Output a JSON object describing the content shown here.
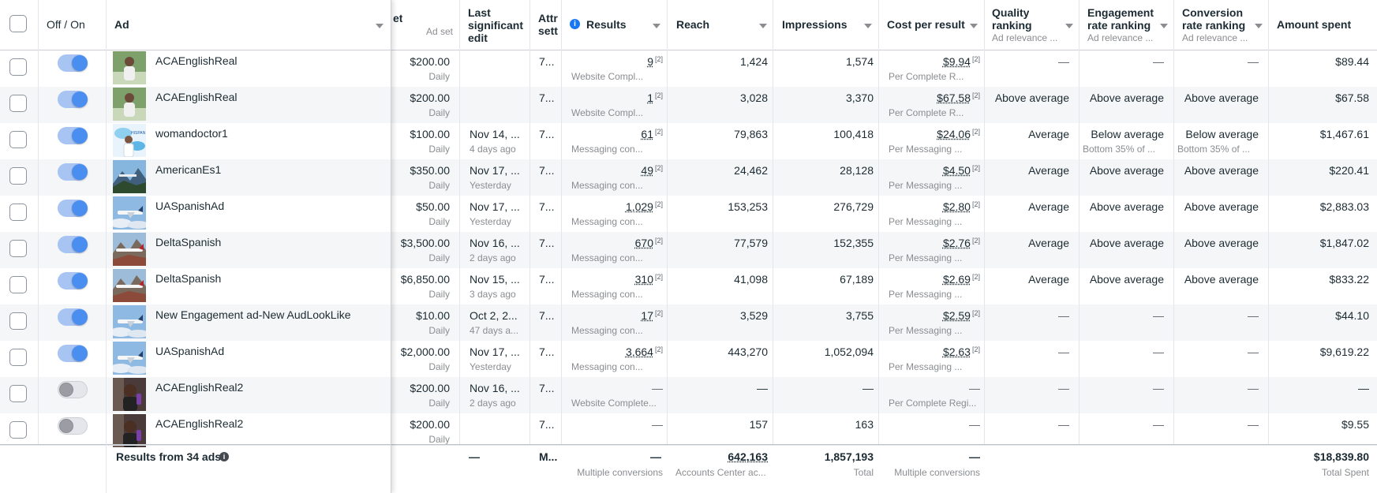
{
  "header": {
    "ad_col": "Ad",
    "budget_fragment": "et",
    "budget_sub": "Ad set",
    "last_edit": [
      "Last",
      "significant",
      "edit"
    ],
    "attribution": [
      "Attr",
      "sett"
    ],
    "results": "Results",
    "reach": "Reach",
    "impressions": "Impressions",
    "cost_per_result": "Cost per result",
    "quality": "Quality",
    "quality_2": "ranking",
    "quality_sub": "Ad relevance ...",
    "engagement": "Engagement",
    "engagement_2": "rate ranking",
    "engagement_sub": "Ad relevance ...",
    "conversion": "Conversion",
    "conversion_2": "rate ranking",
    "conversion_sub": "Ad relevance ...",
    "amount_spent": "Amount spent",
    "off_on": "Off / On"
  },
  "rows": [
    {
      "on": true,
      "ad": "ACAEnglishReal",
      "thumb": "person-green",
      "budget": "$200.00",
      "budget_sub": "Daily",
      "edit": "",
      "edit_sub": "",
      "attr": "7...",
      "results": "9",
      "results_sub": "Website Compl...",
      "reach": "1,424",
      "impressions": "1,574",
      "cpr": "$9.94",
      "cpr_sub": "Per Complete R...",
      "quality": "—",
      "quality_sub": "",
      "engagement": "—",
      "engagement_sub": "",
      "conversion": "—",
      "conversion_sub": "",
      "spent": "$89.44"
    },
    {
      "on": true,
      "ad": "ACAEnglishReal",
      "thumb": "person-green",
      "budget": "$200.00",
      "budget_sub": "Daily",
      "edit": "",
      "edit_sub": "",
      "attr": "7...",
      "results": "1",
      "results_sub": "Website Compl...",
      "reach": "3,028",
      "impressions": "3,370",
      "cpr": "$67.58",
      "cpr_sub": "Per Complete R...",
      "quality": "Above average",
      "quality_sub": "",
      "engagement": "Above average",
      "engagement_sub": "",
      "conversion": "Above average",
      "conversion_sub": "",
      "spent": "$67.58"
    },
    {
      "on": true,
      "ad": "womandoctor1",
      "thumb": "doctor",
      "budget": "$100.00",
      "budget_sub": "Daily",
      "edit": "Nov 14, ...",
      "edit_sub": "4 days ago",
      "attr": "7...",
      "results": "61",
      "results_sub": "Messaging con...",
      "reach": "79,863",
      "impressions": "100,418",
      "cpr": "$24.06",
      "cpr_sub": "Per Messaging ...",
      "quality": "Average",
      "quality_sub": "",
      "engagement": "Below average",
      "engagement_sub": "Bottom 35% of ...",
      "conversion": "Below average",
      "conversion_sub": "Bottom 35% of ...",
      "spent": "$1,467.61"
    },
    {
      "on": true,
      "ad": "AmericanEs1",
      "thumb": "mountain",
      "budget": "$350.00",
      "budget_sub": "Daily",
      "edit": "Nov 17, ...",
      "edit_sub": "Yesterday",
      "attr": "7...",
      "results": "49",
      "results_sub": "Messaging con...",
      "reach": "24,462",
      "impressions": "28,128",
      "cpr": "$4.50",
      "cpr_sub": "Per Messaging ...",
      "quality": "Average",
      "quality_sub": "",
      "engagement": "Above average",
      "engagement_sub": "",
      "conversion": "Above average",
      "conversion_sub": "",
      "spent": "$220.41"
    },
    {
      "on": true,
      "ad": "UASpanishAd",
      "thumb": "plane-sky",
      "budget": "$50.00",
      "budget_sub": "Daily",
      "edit": "Nov 17, ...",
      "edit_sub": "Yesterday",
      "attr": "7...",
      "results": "1,029",
      "results_sub": "Messaging con...",
      "reach": "153,253",
      "impressions": "276,729",
      "cpr": "$2.80",
      "cpr_sub": "Per Messaging ...",
      "quality": "Average",
      "quality_sub": "",
      "engagement": "Above average",
      "engagement_sub": "",
      "conversion": "Above average",
      "conversion_sub": "",
      "spent": "$2,883.03"
    },
    {
      "on": true,
      "ad": "DeltaSpanish",
      "thumb": "plane-mountain",
      "budget": "$3,500.00",
      "budget_sub": "Daily",
      "edit": "Nov 16, ...",
      "edit_sub": "2 days ago",
      "attr": "7...",
      "results": "670",
      "results_sub": "Messaging con...",
      "reach": "77,579",
      "impressions": "152,355",
      "cpr": "$2.76",
      "cpr_sub": "Per Messaging ...",
      "quality": "Average",
      "quality_sub": "",
      "engagement": "Above average",
      "engagement_sub": "",
      "conversion": "Above average",
      "conversion_sub": "",
      "spent": "$1,847.02"
    },
    {
      "on": true,
      "ad": "DeltaSpanish",
      "thumb": "plane-mountain",
      "budget": "$6,850.00",
      "budget_sub": "Daily",
      "edit": "Nov 15, ...",
      "edit_sub": "3 days ago",
      "attr": "7...",
      "results": "310",
      "results_sub": "Messaging con...",
      "reach": "41,098",
      "impressions": "67,189",
      "cpr": "$2.69",
      "cpr_sub": "Per Messaging ...",
      "quality": "Average",
      "quality_sub": "",
      "engagement": "Above average",
      "engagement_sub": "",
      "conversion": "Above average",
      "conversion_sub": "",
      "spent": "$833.22"
    },
    {
      "on": true,
      "ad": "New Engagement ad-New AudLookLike",
      "thumb": "plane-sky",
      "budget": "$10.00",
      "budget_sub": "Daily",
      "edit": "Oct 2, 2...",
      "edit_sub": "47 days a...",
      "attr": "7...",
      "results": "17",
      "results_sub": "Messaging con...",
      "reach": "3,529",
      "impressions": "3,755",
      "cpr": "$2.59",
      "cpr_sub": "Per Messaging ...",
      "quality": "—",
      "quality_sub": "",
      "engagement": "—",
      "engagement_sub": "",
      "conversion": "—",
      "conversion_sub": "",
      "spent": "$44.10"
    },
    {
      "on": true,
      "ad": "UASpanishAd",
      "thumb": "plane-sky",
      "budget": "$2,000.00",
      "budget_sub": "Daily",
      "edit": "Nov 17, ...",
      "edit_sub": "Yesterday",
      "attr": "7...",
      "results": "3,664",
      "results_sub": "Messaging con...",
      "reach": "443,270",
      "impressions": "1,052,094",
      "cpr": "$2.63",
      "cpr_sub": "Per Messaging ...",
      "quality": "—",
      "quality_sub": "",
      "engagement": "—",
      "engagement_sub": "",
      "conversion": "—",
      "conversion_sub": "",
      "spent": "$9,619.22"
    },
    {
      "on": false,
      "ad": "ACAEnglishReal2",
      "thumb": "person-dark",
      "budget": "$200.00",
      "budget_sub": "Daily",
      "edit": "Nov 16, ...",
      "edit_sub": "2 days ago",
      "attr": "7...",
      "results": "—",
      "results_sub": "Website Complete...",
      "reach": "—",
      "impressions": "—",
      "cpr": "—",
      "cpr_sub": "Per Complete Regi...",
      "quality": "—",
      "quality_sub": "",
      "engagement": "—",
      "engagement_sub": "",
      "conversion": "—",
      "conversion_sub": "",
      "spent": "—"
    },
    {
      "on": false,
      "ad": "ACAEnglishReal2",
      "thumb": "person-dark",
      "budget": "$200.00",
      "budget_sub": "Daily",
      "edit": "",
      "edit_sub": "",
      "attr": "7...",
      "results": "—",
      "results_sub": "",
      "reach": "157",
      "impressions": "163",
      "cpr": "—",
      "cpr_sub": "",
      "quality": "—",
      "quality_sub": "",
      "engagement": "—",
      "engagement_sub": "",
      "conversion": "—",
      "conversion_sub": "",
      "spent": "$9.55"
    }
  ],
  "footer": {
    "label": "Results from 34 ads",
    "edit": "—",
    "attr": "M...",
    "results": "—",
    "results_sub": "Multiple conversions",
    "reach": "642,163",
    "reach_sub": "Accounts Center ac...",
    "impressions": "1,857,193",
    "impressions_sub": "Total",
    "cpr": "—",
    "cpr_sub": "Multiple conversions",
    "spent": "$18,839.80",
    "spent_sub": "Total Spent"
  },
  "colors": {
    "toggle_on": "#4a8ef0",
    "alt_row": "#f5f6f7",
    "info_icon": "#1877f2"
  }
}
